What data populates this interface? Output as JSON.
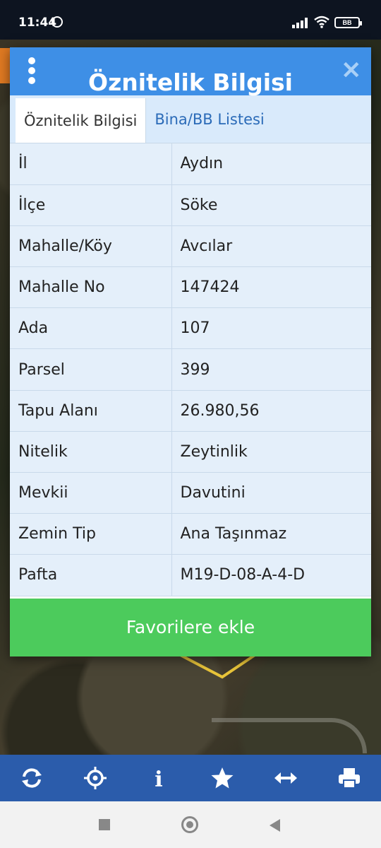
{
  "status_bar": {
    "time": "11:44",
    "battery": "BB"
  },
  "dialog": {
    "title": "Öznitelik Bilgisi",
    "close_label": "✕",
    "tabs": [
      {
        "label": "Öznitelik Bilgisi",
        "active": true
      },
      {
        "label": "Bina/BB Listesi",
        "active": false
      }
    ],
    "rows": [
      {
        "key": "İl",
        "value": "Aydın"
      },
      {
        "key": "İlçe",
        "value": "Söke"
      },
      {
        "key": "Mahalle/Köy",
        "value": "Avcılar"
      },
      {
        "key": "Mahalle No",
        "value": "147424"
      },
      {
        "key": "Ada",
        "value": "107"
      },
      {
        "key": "Parsel",
        "value": "399"
      },
      {
        "key": "Tapu Alanı",
        "value": "26.980,56"
      },
      {
        "key": "Nitelik",
        "value": "Zeytinlik"
      },
      {
        "key": "Mevkii",
        "value": "Davutini"
      },
      {
        "key": "Zemin Tip",
        "value": "Ana Taşınmaz"
      },
      {
        "key": "Pafta",
        "value": "M19-D-08-A-4-D"
      }
    ],
    "favorite_button": "Favorilere ekle"
  },
  "toolbar": {
    "icons": [
      "refresh-icon",
      "locate-icon",
      "info-icon",
      "star-icon",
      "measure-icon",
      "print-icon"
    ],
    "info_glyph": "i"
  },
  "colors": {
    "header": "#3e8fe6",
    "tabs_bg": "#d9eafb",
    "table_bg": "#e4effa",
    "button": "#4ccb5c",
    "toolbar": "#2b5cab"
  }
}
